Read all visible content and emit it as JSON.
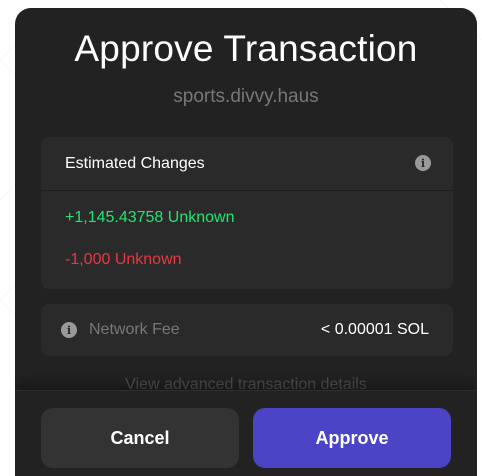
{
  "dialog": {
    "title": "Approve Transaction",
    "origin": "sports.divvy.haus"
  },
  "changes": {
    "header": "Estimated Changes",
    "info_icon": "info-icon",
    "items": [
      {
        "text": "+1,145.43758 Unknown",
        "kind": "increase",
        "color": "#21e56f"
      },
      {
        "text": "-1,000 Unknown",
        "kind": "decrease",
        "color": "#eb3742"
      }
    ]
  },
  "fee": {
    "label": "Network Fee",
    "value": "< 0.00001 SOL",
    "info_icon": "info-icon"
  },
  "advanced": {
    "link_text": "View advanced transaction details"
  },
  "actions": {
    "cancel_label": "Cancel",
    "approve_label": "Approve"
  },
  "colors": {
    "panel": "#222222",
    "card": "#2a2a2a",
    "accent": "#4c44c6",
    "muted_text": "#777777"
  }
}
